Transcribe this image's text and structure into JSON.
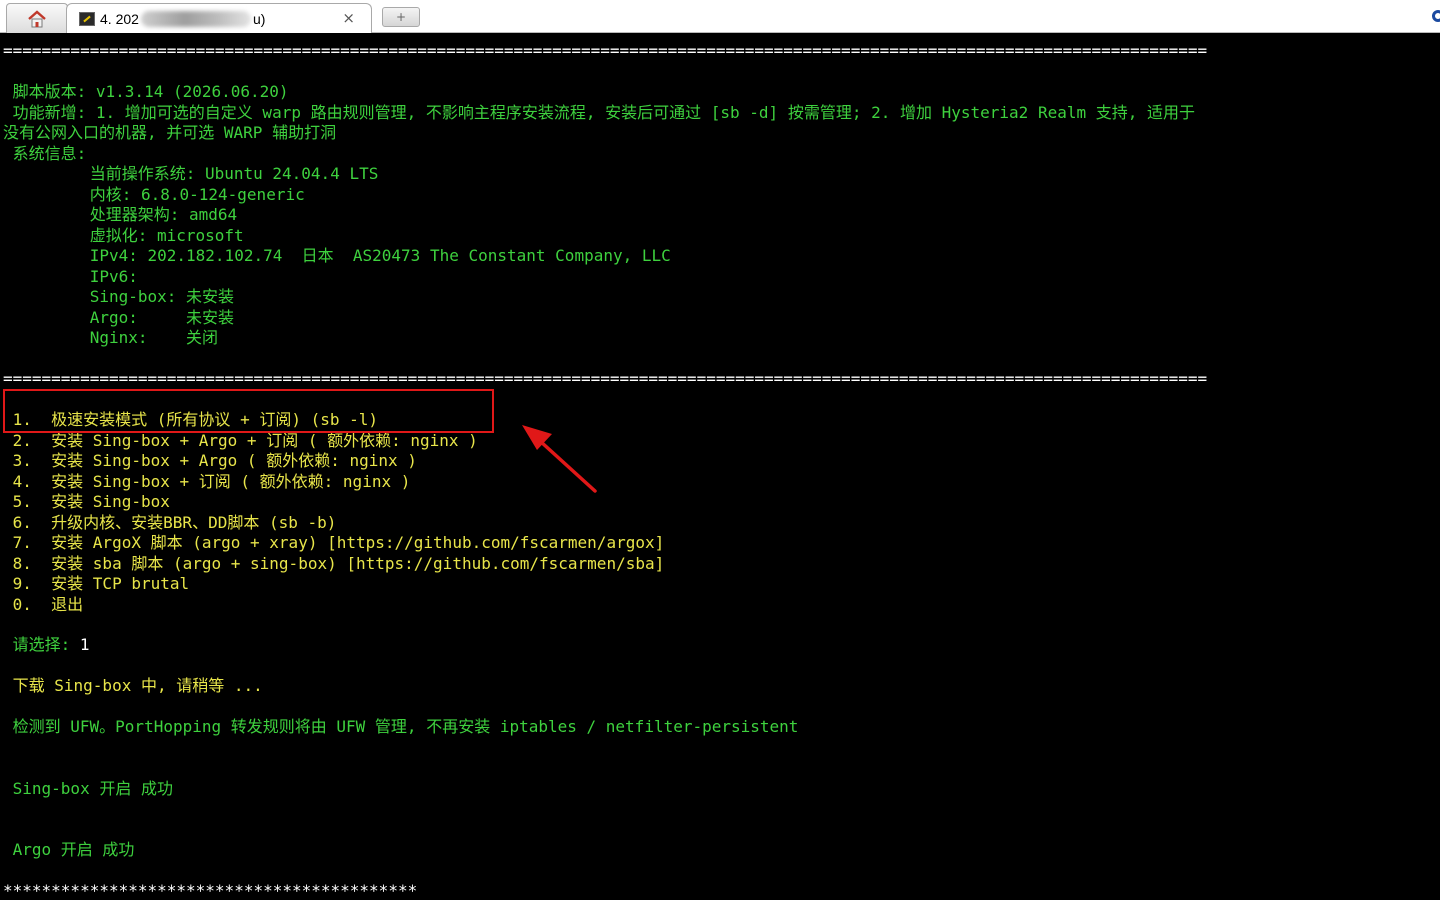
{
  "tabs": {
    "session_title_prefix": "4. 202",
    "session_title_suffix": "u)",
    "close_glyph": "×",
    "new_tab_glyph": "+"
  },
  "terminal": {
    "rule": "=============================================================================================================================",
    "version_line": " 脚本版本: v1.3.14 (2026.06.20)",
    "feature_line1": " 功能新增: 1. 增加可选的自定义 warp 路由规则管理, 不影响主程序安装流程, 安装后可通过 [sb -d] 按需管理; 2. 增加 Hysteria2 Realm 支持, 适用于",
    "feature_line2": "没有公网入口的机器, 并可选 WARP 辅助打洞",
    "sysinfo_label": " 系统信息:",
    "sys_os": "         当前操作系统: Ubuntu 24.04.4 LTS",
    "sys_kernel": "         内核: 6.8.0-124-generic",
    "sys_arch": "         处理器架构: amd64",
    "sys_virt": "         虚拟化: microsoft",
    "sys_ipv4": "         IPv4: 202.182.102.74  日本  AS20473 The Constant Company, LLC",
    "sys_ipv6": "         IPv6:",
    "sys_singbox": "         Sing-box: 未安装",
    "sys_argo": "         Argo:     未安装",
    "sys_nginx": "         Nginx:    关闭",
    "menu": [
      " 1.  极速安装模式 (所有协议 + 订阅) (sb -l)",
      " 2.  安装 Sing-box + Argo + 订阅 ( 额外依赖: nginx )",
      " 3.  安装 Sing-box + Argo ( 额外依赖: nginx )",
      " 4.  安装 Sing-box + 订阅 ( 额外依赖: nginx )",
      " 5.  安装 Sing-box",
      " 6.  升级内核、安装BBR、DD脚本 (sb -b)",
      " 7.  安装 ArgoX 脚本 (argo + xray) [https://github.com/fscarmen/argox]",
      " 8.  安装 sba 脚本 (argo + sing-box) [https://github.com/fscarmen/sba]",
      " 9.  安装 TCP brutal",
      " 0.  退出"
    ],
    "prompt_label": " 请选择: ",
    "prompt_value": "1",
    "download_msg": " 下载 Sing-box 中, 请稍等 ...",
    "ufw_msg": " 检测到 UFW。PortHopping 转发规则将由 UFW 管理, 不再安装 iptables / netfilter-persistent",
    "singbox_ok": " Sing-box 开启 成功",
    "argo_ok": " Argo 开启 成功",
    "stars": "*******************************************"
  },
  "colors": {
    "highlight_box": "#e01818",
    "arrow": "#e01818",
    "green_text": "#3ed13e",
    "yellow_text": "#e8e54a"
  },
  "icons": [
    "home-icon",
    "terminal-icon",
    "close-icon",
    "new-tab-icon",
    "arrow-annotation-icon"
  ]
}
